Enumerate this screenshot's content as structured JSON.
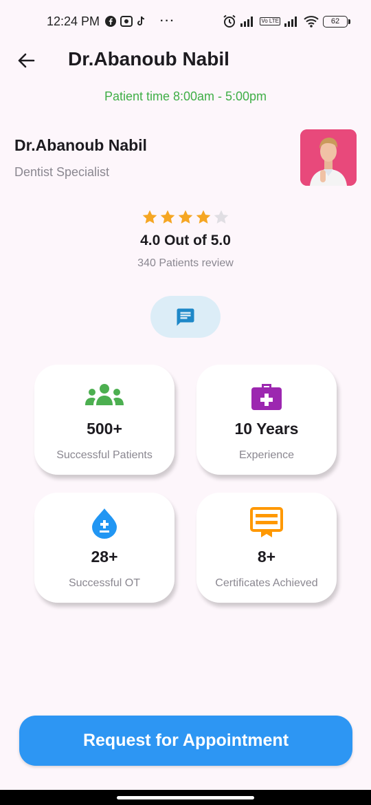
{
  "status_bar": {
    "time": "12:24 PM",
    "more": "···",
    "volte": "Vo LTE",
    "battery": "62"
  },
  "header": {
    "title": "Dr.Abanoub Nabil"
  },
  "patient_time": "Patient time 8:00am - 5:00pm",
  "doctor": {
    "name": "Dr.Abanoub Nabil",
    "specialty": "Dentist Specialist"
  },
  "rating": {
    "stars_filled": 4,
    "stars_total": 5,
    "text": "4.0 Out of 5.0",
    "reviews": "340 Patients review"
  },
  "stats": [
    {
      "icon": "group-icon",
      "color": "#4caf50",
      "value": "500+",
      "label": "Successful Patients"
    },
    {
      "icon": "medical-bag-icon",
      "color": "#9c27b0",
      "value": "10 Years",
      "label": "Experience"
    },
    {
      "icon": "blood-drop-icon",
      "color": "#2196f3",
      "value": "28+",
      "label": "Successful OT"
    },
    {
      "icon": "certificate-icon",
      "color": "#ff9800",
      "value": "8+",
      "label": "Certificates Achieved"
    }
  ],
  "cta": {
    "label": "Request for Appointment"
  },
  "colors": {
    "accent": "#2d96f3",
    "patient_time": "#3fae46",
    "star": "#f5a623"
  }
}
